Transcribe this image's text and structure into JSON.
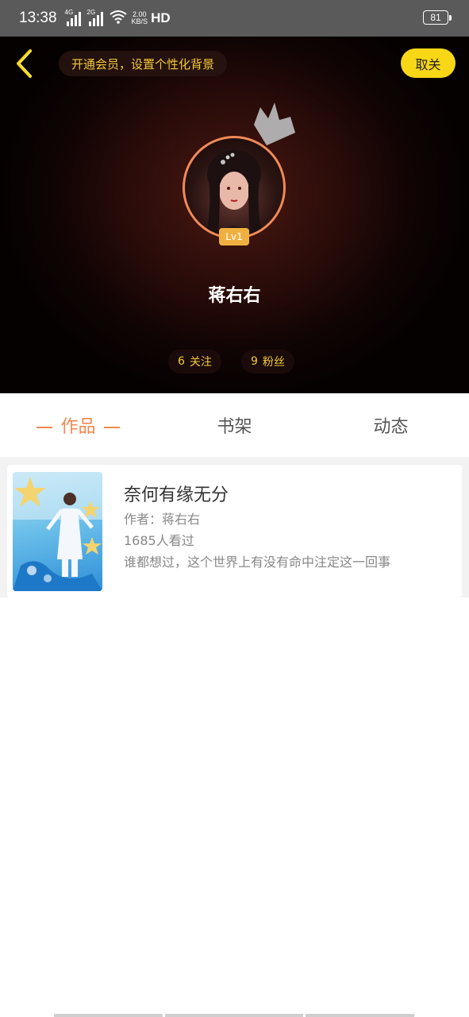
{
  "status_bar": {
    "time": "13:38",
    "signal1": "4G",
    "signal2": "2G",
    "speed_value": "2.00",
    "speed_unit": "KB/S",
    "hd": "HD",
    "battery": "81"
  },
  "header": {
    "vip_banner": "开通会员，设置个性化背景",
    "unfollow_label": "取关",
    "level": "Lv1",
    "username": "蒋右右",
    "following_count": "6",
    "following_label": "关注",
    "fans_count": "9",
    "fans_label": "粉丝"
  },
  "tabs": [
    {
      "label": "作品",
      "active": true
    },
    {
      "label": "书架",
      "active": false
    },
    {
      "label": "动态",
      "active": false
    }
  ],
  "books": [
    {
      "title": "奈何有缘无分",
      "author": "作者：蒋右右",
      "views": "1685人看过",
      "description": "谁都想过，这个世界上有没有命中注定这一回事"
    }
  ],
  "colors": {
    "accent_orange": "#f0884e",
    "accent_yellow": "#f7d716",
    "gold_text": "#f4c935"
  },
  "icons": {
    "back": "chevron-left-icon",
    "crown": "crown-icon"
  }
}
